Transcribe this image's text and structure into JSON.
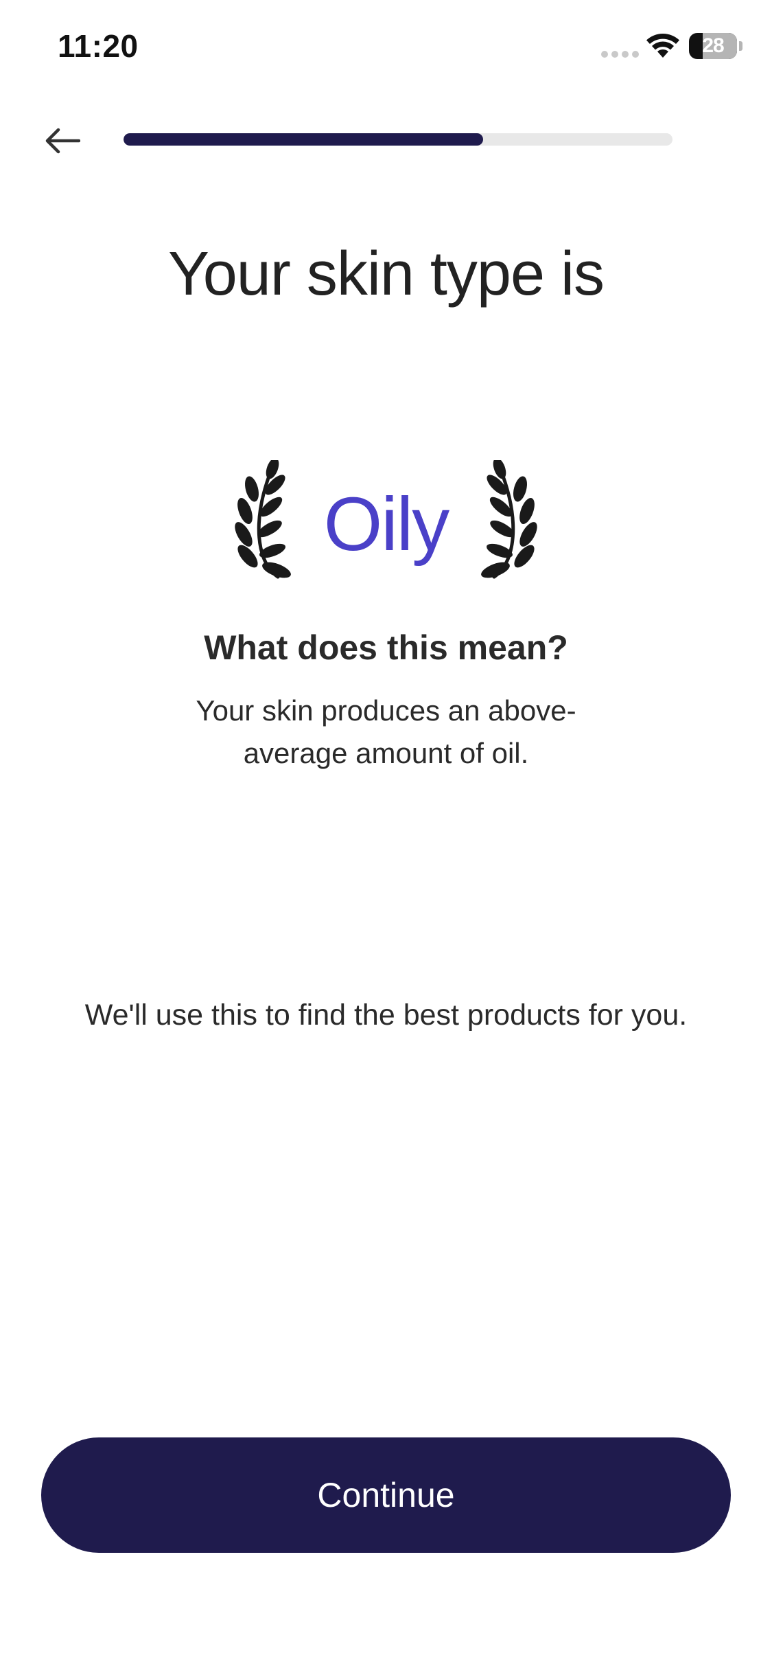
{
  "status_bar": {
    "time": "11:20",
    "battery_level": "28",
    "battery_fraction": 0.28
  },
  "header": {
    "back_icon": "arrow-left-icon",
    "progress_fraction": 0.655,
    "progress_color": "#1f1b4d",
    "progress_track_color": "#e8e8e8"
  },
  "content": {
    "title": "Your skin type is",
    "result": "Oily",
    "result_color": "#4a40c8",
    "laurel_icon": "laurel-branch-icon",
    "meaning_heading": "What does this mean?",
    "meaning_text": "Your skin produces an above-average amount of oil.",
    "info_text": "We'll use this to find the best products for you."
  },
  "footer": {
    "continue_label": "Continue",
    "button_color": "#1f1b4d"
  }
}
